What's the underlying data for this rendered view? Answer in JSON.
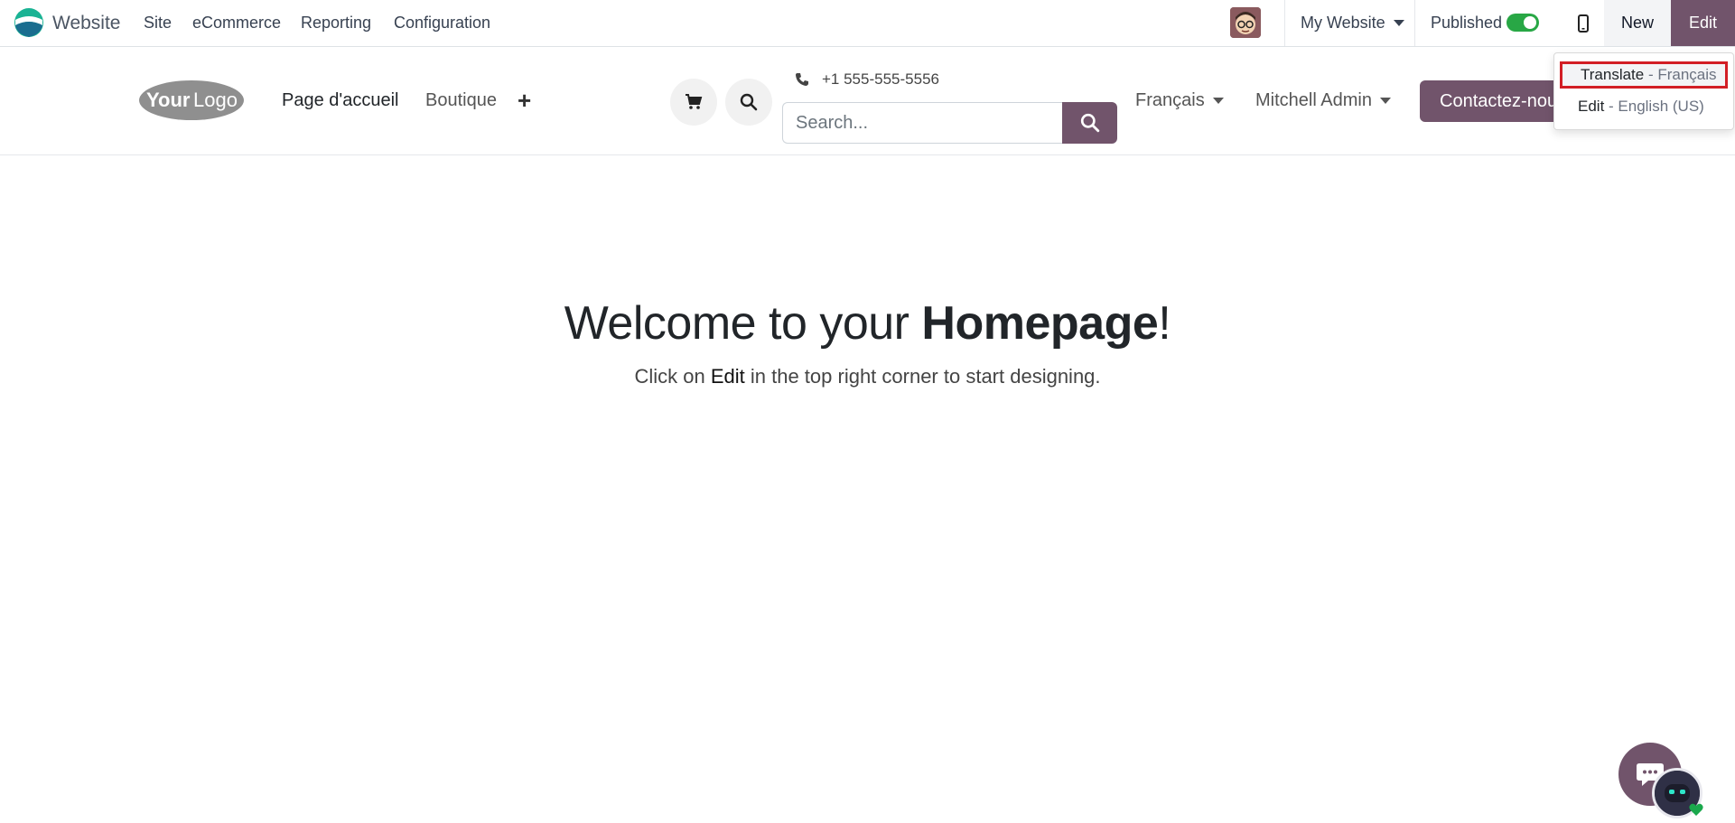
{
  "topbar": {
    "app_name": "Website",
    "menu": [
      "Site",
      "eCommerce",
      "Reporting",
      "Configuration"
    ],
    "my_website": "My Website",
    "published_label": "Published",
    "published_on": true,
    "new_label": "New",
    "edit_label": "Edit"
  },
  "header": {
    "nav": [
      "Page d'accueil",
      "Boutique"
    ],
    "phone": "+1 555-555-5556",
    "search_placeholder": "Search...",
    "language": "Français",
    "user": "Mitchell Admin",
    "contact_label": "Contactez-nous"
  },
  "dropdown": {
    "translate_action": "Translate",
    "translate_lang": "Français",
    "edit_action": "Edit",
    "edit_lang": "English (US)",
    "separator": " - "
  },
  "hero": {
    "title_prefix": "Welcome to your ",
    "title_bold": "Homepage",
    "title_suffix": "!",
    "sub_prefix": "Click on ",
    "sub_em": "Edit",
    "sub_suffix": " in the top right corner to start designing."
  },
  "colors": {
    "brand": "#71546b",
    "toggle_on": "#28a745",
    "highlight": "#d21e25"
  },
  "icons": [
    "website-app-icon",
    "user-avatar",
    "mobile-icon",
    "yourlogo",
    "cart-icon",
    "search-icon",
    "phone-icon",
    "chat-icon",
    "bot-avatar",
    "online-status-icon"
  ]
}
